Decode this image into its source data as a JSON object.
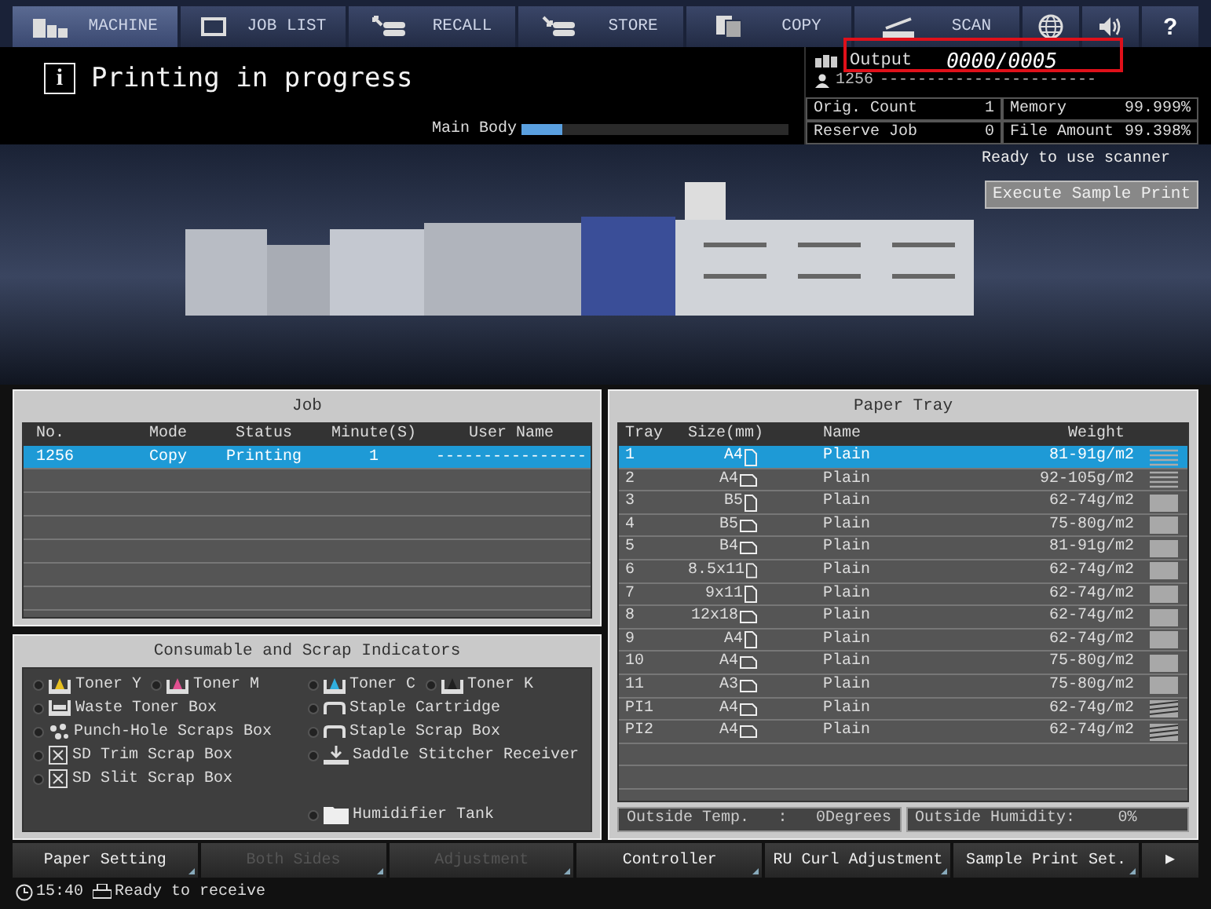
{
  "nav": [
    {
      "label": "MACHINE",
      "selected": true
    },
    {
      "label": "JOB LIST",
      "selected": false
    },
    {
      "label": "RECALL",
      "selected": false
    },
    {
      "label": "STORE",
      "selected": false
    },
    {
      "label": "COPY",
      "selected": false
    },
    {
      "label": "SCAN",
      "selected": false
    },
    {
      "selected": false
    },
    {
      "selected": false
    },
    {
      "label": "?",
      "selected": false
    }
  ],
  "header": {
    "info_icon": "i",
    "title": "Printing in progress",
    "main_body_label": "Main Body",
    "main_body": {
      "level": 0.15
    },
    "output_label": "Output",
    "output_value": "0000/0005",
    "job_number": "1256",
    "user": "-----------------------",
    "stats": [
      {
        "label": "Orig. Count",
        "value": "1",
        "label2": "Memory",
        "value2": "99.999%"
      },
      {
        "label": "Reserve Job",
        "value": "0",
        "label2": "File Amount",
        "value2": "99.398%"
      }
    ]
  },
  "machine": {
    "scanner_status": "Ready to use scanner",
    "sample_button": "Execute Sample Print"
  },
  "job": {
    "title": "Job",
    "columns": [
      "No.",
      "Mode",
      "Status",
      "Minute(S)",
      "User Name"
    ],
    "rows": [
      {
        "cells": [
          "1256",
          "Copy",
          "Printing",
          "1",
          "----------------"
        ],
        "selected": true
      }
    ]
  },
  "consumables": {
    "title": "Consumable and Scrap Indicators",
    "left": [
      {
        "items": [
          {
            "label": "Toner Y",
            "kind": "toner",
            "color": "#e8c020"
          },
          {
            "label": "Toner M",
            "kind": "toner",
            "color": "#e05090"
          }
        ]
      },
      {
        "items": [
          {
            "label": "Waste Toner Box",
            "kind": "waste"
          }
        ]
      },
      {
        "items": [
          {
            "label": "Punch-Hole Scraps Box",
            "kind": "punch"
          }
        ]
      },
      {
        "items": [
          {
            "label": "SD Trim Scrap Box",
            "kind": "trim"
          }
        ]
      },
      {
        "items": [
          {
            "label": "SD Slit Scrap Box",
            "kind": "trim"
          }
        ]
      }
    ],
    "right": [
      {
        "items": [
          {
            "label": "Toner C",
            "kind": "toner",
            "color": "#30b0e0"
          },
          {
            "label": "Toner K",
            "kind": "toner",
            "color": "#202020"
          }
        ]
      },
      {
        "items": [
          {
            "label": "Staple Cartridge",
            "kind": "staple"
          }
        ]
      },
      {
        "items": [
          {
            "label": "Staple Scrap Box",
            "kind": "staple"
          }
        ]
      },
      {
        "items": [
          {
            "label": "Saddle Stitcher Receiver",
            "kind": "saddle"
          }
        ]
      }
    ],
    "bottom": {
      "label": "Humidifier Tank",
      "kind": "tank"
    }
  },
  "paper_tray": {
    "title": "Paper Tray",
    "columns": [
      "Tray",
      "Size(mm)",
      "Name",
      "Weight"
    ],
    "rows": [
      {
        "tray": "1",
        "size": "A4",
        "landscape": false,
        "name": "Plain",
        "weight": "81-91g/m2",
        "kind": "lines",
        "selected": true
      },
      {
        "tray": "2",
        "size": "A4",
        "landscape": true,
        "name": "Plain",
        "weight": "92-105g/m2",
        "kind": "lines",
        "selected": false
      },
      {
        "tray": "3",
        "size": "B5",
        "landscape": false,
        "name": "Plain",
        "weight": "62-74g/m2",
        "kind": "block",
        "selected": false
      },
      {
        "tray": "4",
        "size": "B5",
        "landscape": true,
        "name": "Plain",
        "weight": "75-80g/m2",
        "kind": "block",
        "selected": false
      },
      {
        "tray": "5",
        "size": "B4",
        "landscape": true,
        "name": "Plain",
        "weight": "81-91g/m2",
        "kind": "block",
        "selected": false
      },
      {
        "tray": "6",
        "size": "8.5x11",
        "landscape": false,
        "name": "Plain",
        "weight": "62-74g/m2",
        "kind": "block",
        "selected": false
      },
      {
        "tray": "7",
        "size": "9x11",
        "landscape": false,
        "name": "Plain",
        "weight": "62-74g/m2",
        "kind": "block",
        "selected": false
      },
      {
        "tray": "8",
        "size": "12x18",
        "landscape": true,
        "name": "Plain",
        "weight": "62-74g/m2",
        "kind": "block",
        "selected": false
      },
      {
        "tray": "9",
        "size": "A4",
        "landscape": false,
        "name": "Plain",
        "weight": "62-74g/m2",
        "kind": "block",
        "selected": false
      },
      {
        "tray": "10",
        "size": "A4",
        "landscape": true,
        "name": "Plain",
        "weight": "75-80g/m2",
        "kind": "block",
        "selected": false
      },
      {
        "tray": "11",
        "size": "A3",
        "landscape": true,
        "name": "Plain",
        "weight": "75-80g/m2",
        "kind": "block",
        "selected": false
      },
      {
        "tray": "PI1",
        "size": "A4",
        "landscape": true,
        "name": "Plain",
        "weight": "62-74g/m2",
        "kind": "stack",
        "selected": false
      },
      {
        "tray": "PI2",
        "size": "A4",
        "landscape": true,
        "name": "Plain",
        "weight": "62-74g/m2",
        "kind": "stack",
        "selected": false
      }
    ],
    "temp_label": "Outside Temp.",
    "temp_sep": ":",
    "temp_value": "0Degrees",
    "humidity_label": "Outside Humidity:",
    "humidity_value": "0%"
  },
  "buttons": [
    {
      "label": "Paper Setting",
      "disabled": false
    },
    {
      "label": "Both Sides",
      "disabled": true
    },
    {
      "label": "Adjustment",
      "disabled": true
    },
    {
      "label": "Controller",
      "disabled": false
    },
    {
      "label": "RU Curl Adjustment",
      "disabled": false
    },
    {
      "label": "Sample Print Set.",
      "disabled": false
    },
    {
      "label": "▶",
      "disabled": false
    }
  ],
  "status_bar": {
    "time": "15:40",
    "message": "Ready to receive"
  }
}
